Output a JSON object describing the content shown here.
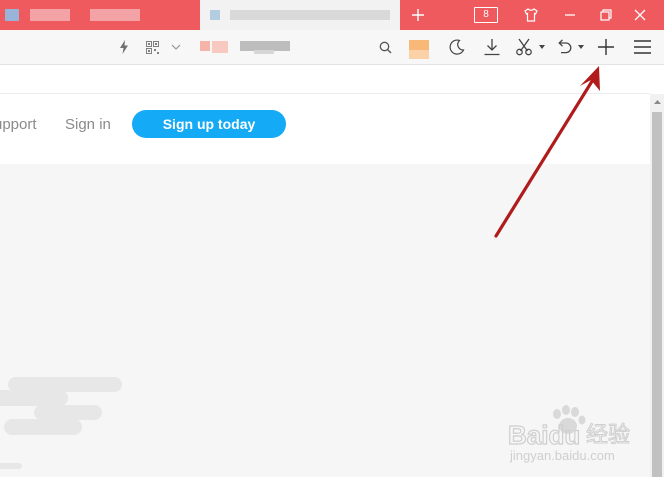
{
  "browser": {
    "tab_count": "8"
  },
  "site_nav": {
    "support_label": "upport",
    "signin_label": "Sign in",
    "signup_label": "Sign up today"
  },
  "watermark": {
    "brand": "Baidu",
    "brand_cn": "经验",
    "url": "jingyan.baidu.com"
  },
  "colors": {
    "titlebar": "#ef5a5f",
    "signup_button": "#14aaf5",
    "annotation_arrow": "#b01c1c"
  },
  "icons": [
    "new-tab-icon",
    "tab-count-icon",
    "skin-icon",
    "minimize-icon",
    "maximize-icon",
    "close-icon",
    "lightning-icon",
    "qr-code-icon",
    "chevron-down-icon",
    "search-icon",
    "moon-icon",
    "download-icon",
    "scissors-icon",
    "undo-icon",
    "plus-icon",
    "menu-icon",
    "annotation-arrow"
  ]
}
